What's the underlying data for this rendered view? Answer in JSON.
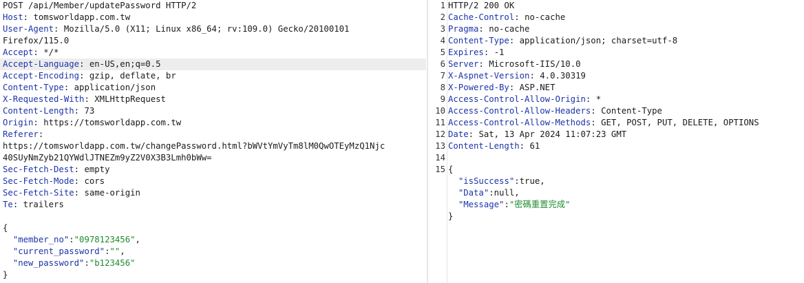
{
  "request": {
    "request_line": "POST /api/Member/updatePassword HTTP/2",
    "headers": [
      {
        "name": "Host",
        "value": "tomsworldapp.com.tw"
      },
      {
        "name": "User-Agent",
        "value": "Mozilla/5.0 (X11; Linux x86_64; rv:109.0) Gecko/20100101",
        "cont": "Firefox/115.0"
      },
      {
        "name": "Accept",
        "value": "*/*"
      },
      {
        "name": "Accept-Language",
        "value": "en-US,en;q=0.5"
      },
      {
        "name": "Accept-Encoding",
        "value": "gzip, deflate, br"
      },
      {
        "name": "Content-Type",
        "value": "application/json"
      },
      {
        "name": "X-Requested-With",
        "value": "XMLHttpRequest"
      },
      {
        "name": "Content-Length",
        "value": "73"
      },
      {
        "name": "Origin",
        "value": "https://tomsworldapp.com.tw"
      },
      {
        "name": "Referer",
        "value": "",
        "cont": "https://tomsworldapp.com.tw/changePassword.html?bWVtYmVyTm8lM0QwOTEyMzQ1Njc",
        "cont2": "40SUyNmZyb21QYWdlJTNEZm9yZ2V0X3B3Lmh0bWw="
      },
      {
        "name": "Sec-Fetch-Dest",
        "value": "empty"
      },
      {
        "name": "Sec-Fetch-Mode",
        "value": "cors"
      },
      {
        "name": "Sec-Fetch-Site",
        "value": "same-origin"
      },
      {
        "name": "Te",
        "value": "trailers"
      }
    ],
    "body": {
      "open": "{",
      "fields": [
        {
          "key": "\"member_no\"",
          "value": "\"0978123456\"",
          "trail": ","
        },
        {
          "key": "\"current_password\"",
          "value": "\"\"",
          "trail": ","
        },
        {
          "key": "\"new_password\"",
          "value": "\"b123456\"",
          "trail": ""
        }
      ],
      "close": "}"
    }
  },
  "response": {
    "lines": [
      {
        "n": "1",
        "plain": "HTTP/2 200 OK"
      },
      {
        "n": "2",
        "name": "Cache-Control",
        "value": "no-cache"
      },
      {
        "n": "3",
        "name": "Pragma",
        "value": "no-cache"
      },
      {
        "n": "4",
        "name": "Content-Type",
        "value": "application/json; charset=utf-8"
      },
      {
        "n": "5",
        "name": "Expires",
        "value": "-1"
      },
      {
        "n": "6",
        "name": "Server",
        "value": "Microsoft-IIS/10.0"
      },
      {
        "n": "7",
        "name": "X-Aspnet-Version",
        "value": "4.0.30319"
      },
      {
        "n": "8",
        "name": "X-Powered-By",
        "value": "ASP.NET"
      },
      {
        "n": "9",
        "name": "Access-Control-Allow-Origin",
        "value": "*"
      },
      {
        "n": "10",
        "name": "Access-Control-Allow-Headers",
        "value": "Content-Type"
      },
      {
        "n": "11",
        "name": "Access-Control-Allow-Methods",
        "value": "GET, POST, PUT, DELETE, OPTIONS"
      },
      {
        "n": "12",
        "name": "Date",
        "value": "Sat, 13 Apr 2024 11:07:23 GMT"
      },
      {
        "n": "13",
        "name": "Content-Length",
        "value": "61"
      },
      {
        "n": "14",
        "plain": ""
      },
      {
        "n": "15",
        "plain": "{"
      }
    ],
    "body_fields": [
      {
        "key": "\"isSuccess\"",
        "value": "true",
        "trail": ",",
        "string": false
      },
      {
        "key": "\"Data\"",
        "value": "null",
        "trail": ",",
        "string": false
      },
      {
        "key": "\"Message\"",
        "value": "\"密碼重置完成\"",
        "trail": "",
        "string": true
      }
    ],
    "body_close": "}"
  }
}
